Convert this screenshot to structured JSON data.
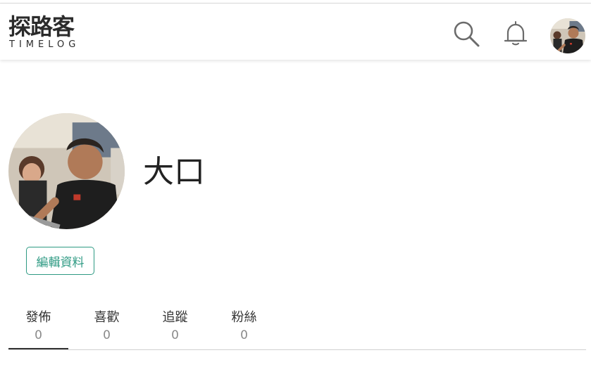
{
  "brand": {
    "name_cn": "探路客",
    "name_en": "TIMELOG"
  },
  "header": {
    "search_icon": "search-icon",
    "notification_icon": "bell-icon",
    "avatar": "user-avatar-photo"
  },
  "profile": {
    "name": "大口",
    "avatar": "user-avatar-photo",
    "edit_button": "編輯資料"
  },
  "tabs": [
    {
      "label": "發佈",
      "count": "0",
      "active": true
    },
    {
      "label": "喜歡",
      "count": "0",
      "active": false
    },
    {
      "label": "追蹤",
      "count": "0",
      "active": false
    },
    {
      "label": "粉絲",
      "count": "0",
      "active": false
    }
  ],
  "colors": {
    "accent": "#2e9a83",
    "text": "#333333",
    "muted": "#8a8a8a"
  }
}
